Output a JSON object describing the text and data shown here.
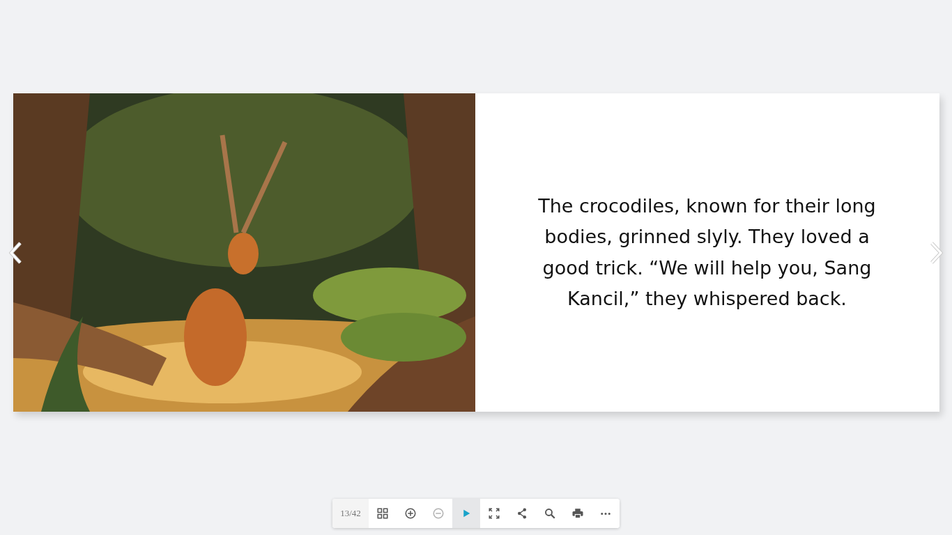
{
  "book": {
    "right_page": {
      "text": "The crocodiles, known for their long bodies, grinned slyly. They loved a good trick. “We will help you, Sang Kancil,” they whispered back."
    }
  },
  "toolbar": {
    "page_counter": "13/42",
    "buttons": [
      {
        "kind": "thumbnails",
        "disabled": false,
        "selected": false
      },
      {
        "kind": "zoom-in",
        "disabled": false,
        "selected": false
      },
      {
        "kind": "zoom-out",
        "disabled": true,
        "selected": false
      },
      {
        "kind": "play",
        "disabled": false,
        "selected": true
      },
      {
        "kind": "fullscreen",
        "disabled": false,
        "selected": false
      },
      {
        "kind": "share",
        "disabled": false,
        "selected": false
      },
      {
        "kind": "search",
        "disabled": false,
        "selected": false
      },
      {
        "kind": "print",
        "disabled": false,
        "selected": false
      },
      {
        "kind": "more",
        "disabled": false,
        "selected": false
      }
    ]
  }
}
